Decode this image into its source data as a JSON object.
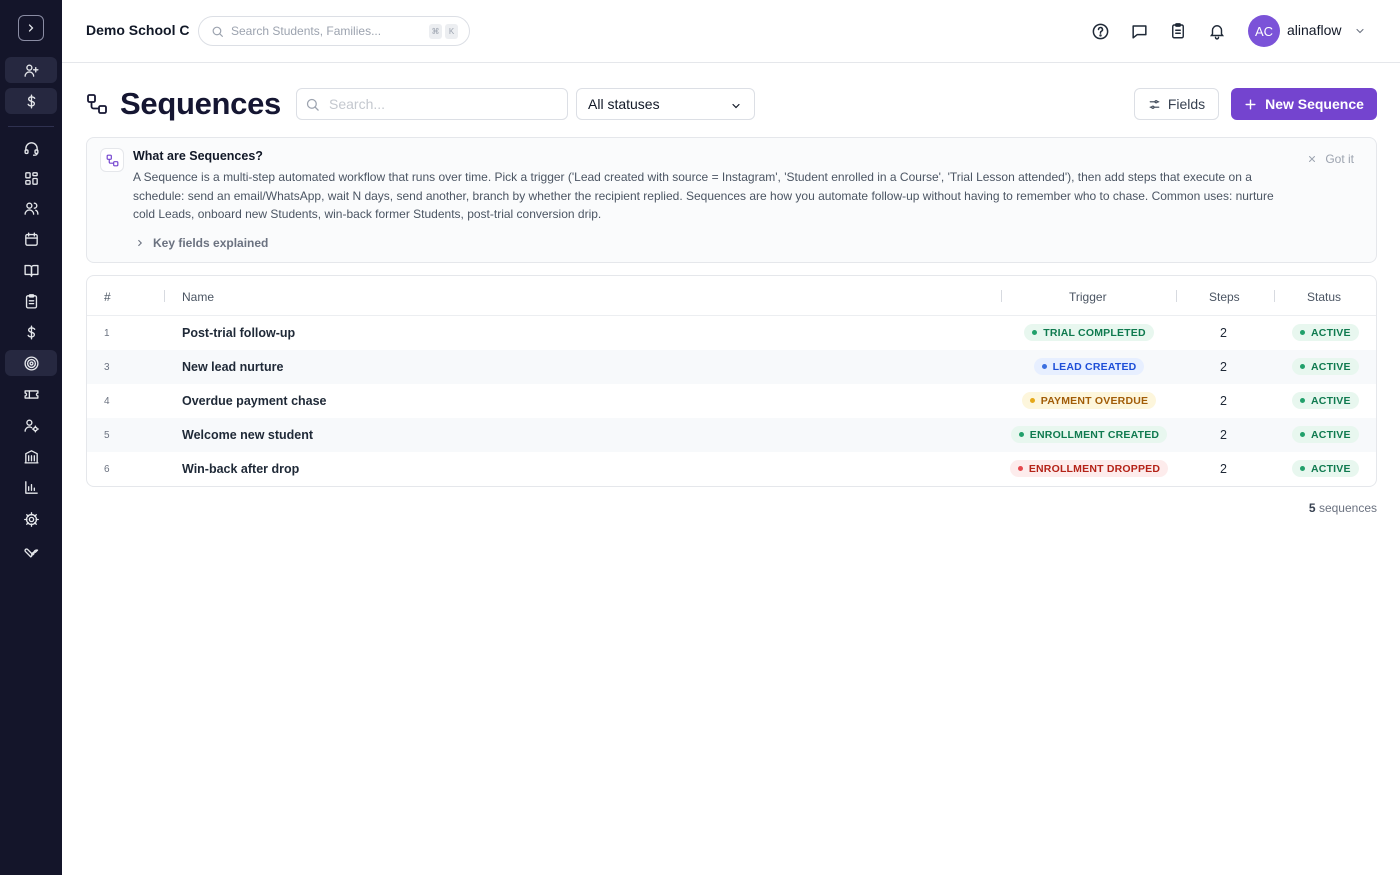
{
  "app": {
    "school_name": "Demo School C"
  },
  "global_search": {
    "placeholder": "Search Students, Families...",
    "shortcut_keys": [
      "⌘",
      "K"
    ]
  },
  "user": {
    "initials": "AC",
    "name": "alinaflow"
  },
  "sidebar": {
    "items": [
      {
        "icon": "user-plus-icon",
        "highlighted": true
      },
      {
        "icon": "dollar-icon",
        "highlighted": true
      },
      {
        "icon": "headset-icon"
      },
      {
        "icon": "dashboard-icon"
      },
      {
        "icon": "users-icon"
      },
      {
        "icon": "calendar-icon"
      },
      {
        "icon": "book-icon"
      },
      {
        "icon": "clipboard-icon"
      },
      {
        "icon": "dollar-icon"
      },
      {
        "icon": "target-icon",
        "highlighted": true
      },
      {
        "icon": "ticket-icon"
      },
      {
        "icon": "user-settings-icon"
      },
      {
        "icon": "building-icon"
      },
      {
        "icon": "chart-icon"
      },
      {
        "icon": "gear-icon"
      },
      {
        "icon": "wrench-icon"
      }
    ]
  },
  "page": {
    "title": "Sequences",
    "search_placeholder": "Search...",
    "status_filter": "All statuses",
    "fields_label": "Fields",
    "new_label": "New Sequence"
  },
  "info": {
    "title": "What are Sequences?",
    "body": "A Sequence is a multi-step automated workflow that runs over time. Pick a trigger ('Lead created with source = Instagram', 'Student enrolled in a Course', 'Trial Lesson attended'), then add steps that execute on a schedule: send an email/WhatsApp, wait N days, send another, branch by whether the recipient replied. Sequences are how you automate follow-up without having to remember who to chase. Common uses: nurture cold Leads, onboard new Students, win-back former Students, post-trial conversion drip.",
    "dismiss_label": "Got it",
    "key_fields_label": "Key fields explained"
  },
  "table": {
    "headers": {
      "num": "#",
      "name": "Name",
      "trigger": "Trigger",
      "steps": "Steps",
      "status": "Status"
    },
    "rows": [
      {
        "num": "1",
        "name": "Post-trial follow-up",
        "trigger": "TRIAL COMPLETED",
        "trigger_color": "#0f7a4f",
        "trigger_bg": "#e8f7ef",
        "trigger_dot": "#22a06b",
        "steps": "2",
        "status": "ACTIVE"
      },
      {
        "num": "3",
        "name": "New lead nurture",
        "trigger": "LEAD CREATED",
        "trigger_color": "#1d4ed8",
        "trigger_bg": "#e7efff",
        "trigger_dot": "#3b6fe0",
        "steps": "2",
        "status": "ACTIVE"
      },
      {
        "num": "4",
        "name": "Overdue payment chase",
        "trigger": "PAYMENT OVERDUE",
        "trigger_color": "#a15c07",
        "trigger_bg": "#fdf6dc",
        "trigger_dot": "#e5a81a",
        "steps": "2",
        "status": "ACTIVE"
      },
      {
        "num": "5",
        "name": "Welcome new student",
        "trigger": "ENROLLMENT CREATED",
        "trigger_color": "#0f7a4f",
        "trigger_bg": "#e8f7ef",
        "trigger_dot": "#22a06b",
        "steps": "2",
        "status": "ACTIVE"
      },
      {
        "num": "6",
        "name": "Win-back after drop",
        "trigger": "ENROLLMENT DROPPED",
        "trigger_color": "#b42318",
        "trigger_bg": "#fdecec",
        "trigger_dot": "#e5484d",
        "steps": "2",
        "status": "ACTIVE"
      }
    ],
    "status_color": "#0f7a4f",
    "status_bg": "#e8f7ef",
    "status_dot": "#22a06b"
  },
  "footer": {
    "count": "5",
    "count_label": "sequences"
  },
  "colors": {
    "accent": "#7444cf",
    "sidebar_bg": "#14152a"
  }
}
